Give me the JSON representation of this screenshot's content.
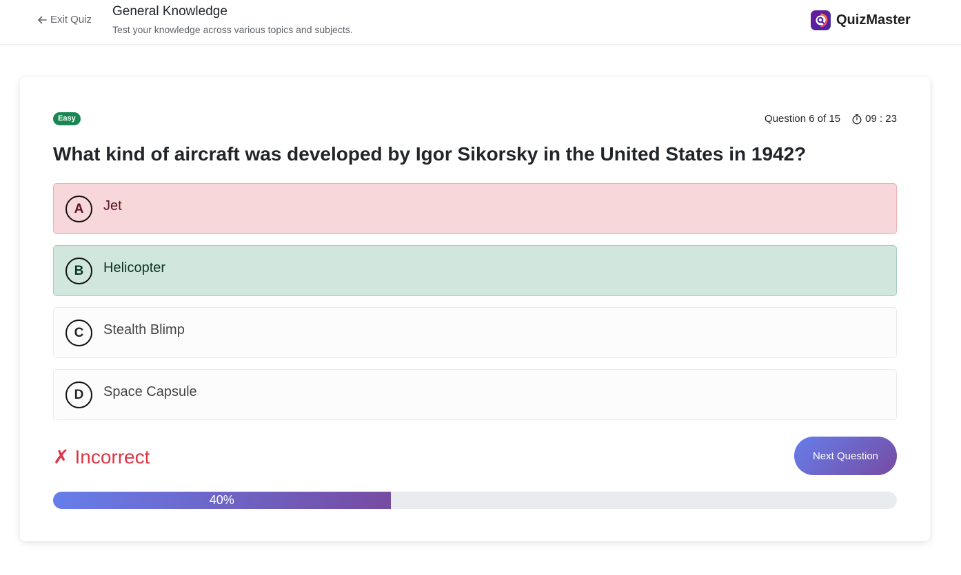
{
  "header": {
    "exit_label": "Exit Quiz",
    "title": "General Knowledge",
    "subtitle": "Test your knowledge across various topics and subjects.",
    "brand": "QuizMaster"
  },
  "quiz": {
    "difficulty": "Easy",
    "question_counter": "Question 6 of 15",
    "timer": "09 : 23",
    "question": "What kind of aircraft was developed by Igor Sikorsky in the United States in 1942?",
    "options": [
      {
        "letter": "A",
        "text": "Jet",
        "state": "incorrect"
      },
      {
        "letter": "B",
        "text": "Helicopter",
        "state": "correct"
      },
      {
        "letter": "C",
        "text": "Stealth Blimp",
        "state": "neutral"
      },
      {
        "letter": "D",
        "text": "Space Capsule",
        "state": "neutral"
      }
    ],
    "result_icon": "✗",
    "result_text": "Incorrect",
    "next_label": "Next Question",
    "progress": 40,
    "progress_label": "40%"
  },
  "colors": {
    "incorrect_bg": "#f8d7da",
    "correct_bg": "#d1e7dd",
    "incorrect_text": "#dc3545",
    "badge_green": "#198754",
    "gradient_start": "#667eea",
    "gradient_end": "#764ba2"
  },
  "icons": {
    "exit": "arrow-left-icon",
    "timer": "stopwatch-icon",
    "brand": "quizmaster-logo"
  }
}
